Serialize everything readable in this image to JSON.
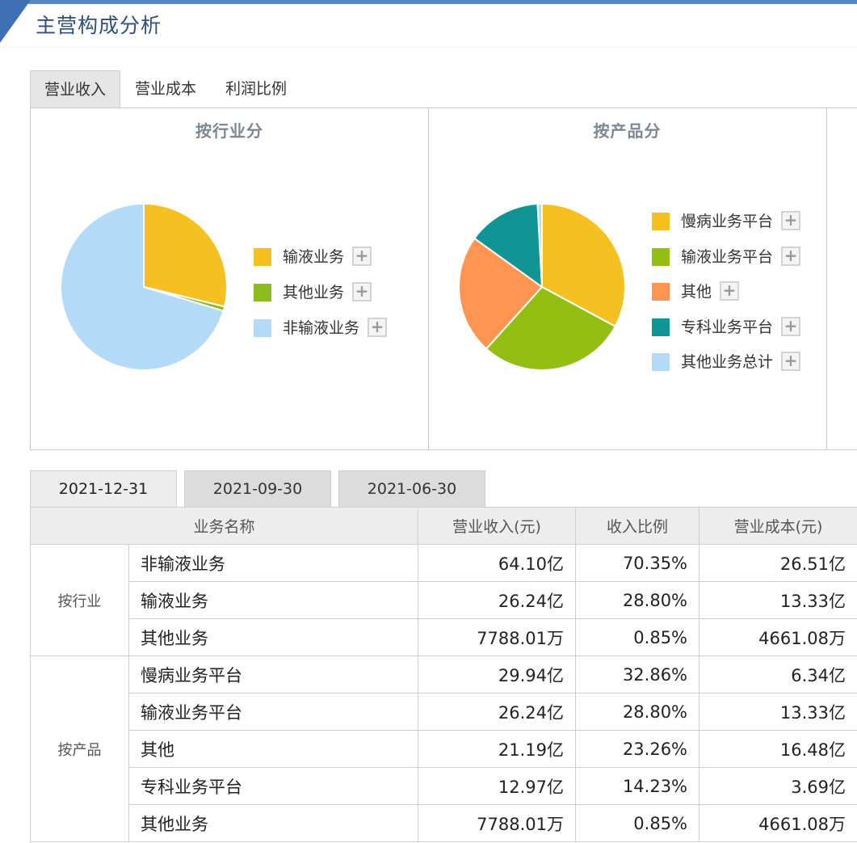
{
  "header": {
    "title": "主营构成分析"
  },
  "top_tabs": [
    "营业收入",
    "营业成本",
    "利润比例"
  ],
  "charts": [
    {
      "title": "按行业分",
      "chart_data": {
        "type": "pie",
        "categories": [
          "输液业务",
          "其他业务",
          "非输液业务"
        ],
        "values": [
          28.8,
          0.85,
          70.35
        ],
        "colors": [
          "#f5c020",
          "#8bbd1c",
          "#b3dbf7"
        ],
        "legend": "right"
      }
    },
    {
      "title": "按产品分",
      "chart_data": {
        "type": "pie",
        "categories": [
          "慢病业务平台",
          "输液业务平台",
          "其他",
          "专科业务平台",
          "其他业务总计"
        ],
        "values": [
          32.86,
          28.8,
          23.26,
          14.23,
          0.85
        ],
        "colors": [
          "#f5c020",
          "#93be12",
          "#ff9552",
          "#119494",
          "#b3dbf7"
        ],
        "legend": "right"
      }
    }
  ],
  "date_tabs": [
    "2021-12-31",
    "2021-09-30",
    "2021-06-30"
  ],
  "table": {
    "headers": [
      "业务名称",
      "营业收入(元)",
      "收入比例",
      "营业成本(元)"
    ],
    "groups": [
      {
        "label": "按行业",
        "rows": [
          [
            "非输液业务",
            "64.10亿",
            "70.35%",
            "26.51亿"
          ],
          [
            "输液业务",
            "26.24亿",
            "28.80%",
            "13.33亿"
          ],
          [
            "其他业务",
            "7788.01万",
            "0.85%",
            "4661.08万"
          ]
        ]
      },
      {
        "label": "按产品",
        "rows": [
          [
            "慢病业务平台",
            "29.94亿",
            "32.86%",
            "6.34亿"
          ],
          [
            "输液业务平台",
            "26.24亿",
            "28.80%",
            "13.33亿"
          ],
          [
            "其他",
            "21.19亿",
            "23.26%",
            "16.48亿"
          ],
          [
            "专科业务平台",
            "12.97亿",
            "14.23%",
            "3.69亿"
          ],
          [
            "其他业务",
            "7788.01万",
            "0.85%",
            "4661.08万"
          ]
        ]
      }
    ]
  }
}
